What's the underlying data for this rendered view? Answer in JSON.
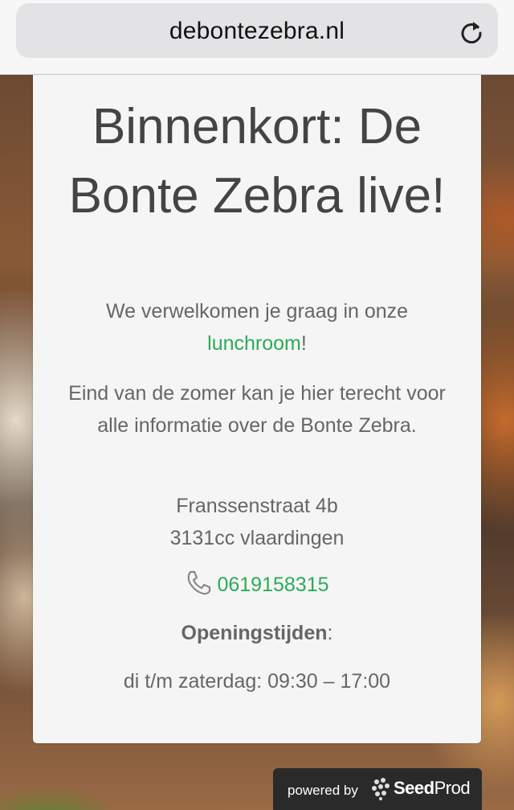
{
  "browser": {
    "url": "debontezebra.nl",
    "reload_icon": "reload-icon"
  },
  "card": {
    "headline": "Binnenkort: De Bonte Zebra live!",
    "welcome_text": "We verwelkomen je graag in onze",
    "welcome_link": "lunchroom",
    "welcome_end": "!",
    "info_text": "Eind van de zomer kan je hier terecht voor alle informatie over de Bonte Zebra.",
    "address_line1": "Franssenstraat 4b",
    "address_line2": "3131cc vlaardingen",
    "phone_icon": "phone-icon",
    "phone": "0619158315",
    "hours_label": "Openingstijden",
    "hours_colon": ":",
    "hours": "di t/m zaterdag: 09:30 – 17:00"
  },
  "footer": {
    "powered_by": "powered by",
    "brand_seed": "Seed",
    "brand_prod": "Prod",
    "logo_icon": "seedprod-logo-icon"
  },
  "colors": {
    "accent": "#2bab57",
    "text": "#666666",
    "headline": "#444444",
    "card": "#f5f5f5"
  }
}
